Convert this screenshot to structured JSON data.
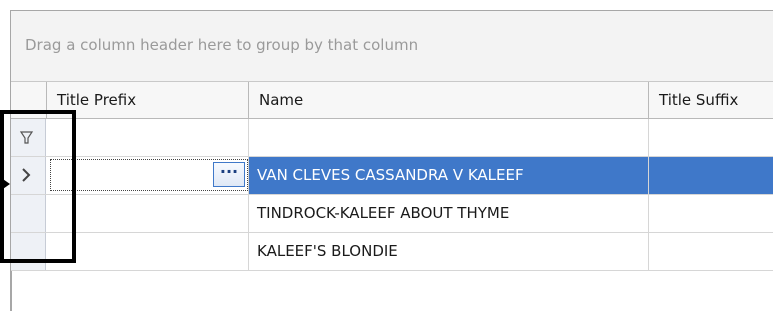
{
  "group_panel": {
    "hint": "Drag a column header here to group by that column"
  },
  "columns": [
    {
      "label": "Title Prefix"
    },
    {
      "label": "Name"
    },
    {
      "label": "Title Suffix"
    }
  ],
  "rows": [
    {
      "title_prefix": "",
      "name": "VAN CLEVES CASSANDRA V KALEEF",
      "title_suffix": "",
      "selected": true
    },
    {
      "title_prefix": "",
      "name": "TINDROCK-KALEEF ABOUT THYME",
      "title_suffix": "",
      "selected": false
    },
    {
      "title_prefix": "",
      "name": "KALEEF'S BLONDIE",
      "title_suffix": "",
      "selected": false
    }
  ],
  "editor": {
    "button_label": "···"
  },
  "icons": {
    "filter": "filter-icon",
    "current_row": "chevron-right-icon"
  },
  "colors": {
    "selection": "#3f78c9",
    "annotation": "#000000"
  }
}
